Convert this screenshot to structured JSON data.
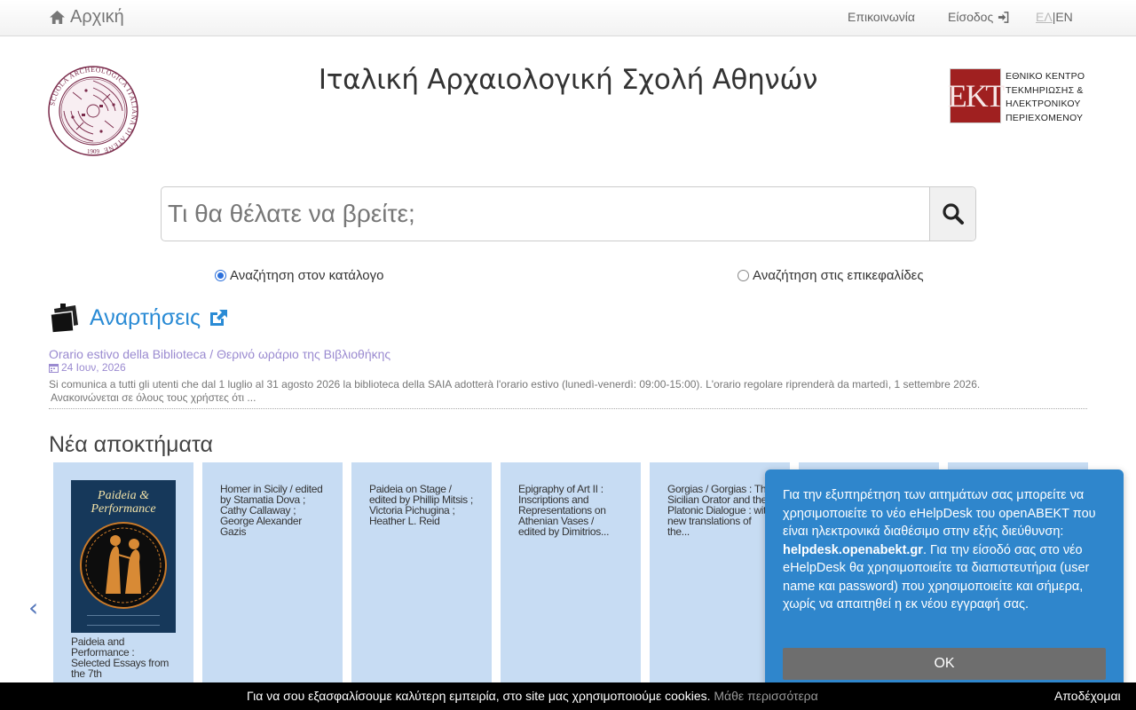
{
  "topnav": {
    "home_label": "Αρχική",
    "contact_label": "Επικοινωνία",
    "login_label": "Είσοδος",
    "lang_el": "ΕΛ",
    "lang_sep": "|",
    "lang_en": "EN"
  },
  "header": {
    "title": "Ιταλική Αρχαιολογική Σχολή Αθηνών",
    "ekt_logo": "ΕΚΤ",
    "ekt_lines": [
      "ΕΘΝΙΚΟ ΚΕΝΤΡΟ",
      "ΤΕΚΜΗΡΙΩΣΗΣ &",
      "ΗΛΕΚΤΡΟΝΙΚΟΥ",
      "ΠΕΡΙΕΧΟΜΕΝΟΥ"
    ],
    "saia_logo_text": "SCUOLA ARCHEOLOGICA ITALIANA DI ATENE",
    "saia_logo_year": "1909"
  },
  "search": {
    "placeholder": "Τι θα θέλατε να βρείτε;",
    "value": "",
    "options": [
      {
        "label": "Αναζήτηση στον κατάλογο",
        "selected": true
      },
      {
        "label": "Αναζήτηση στις επικεφαλίδες",
        "selected": false
      }
    ]
  },
  "announcements": {
    "title": "Αναρτήσεις",
    "item": {
      "link": "Orario estivo della Biblioteca / Θερινό ωράριο της Βιβλιοθήκης",
      "date": "24 Ιουν, 2026",
      "body_line1": "Si comunica a tutti gli utenti che dal 1 luglio al 31 agosto 2026 la biblioteca della SAIA adotterà l'orario estivo (lunedì-venerdì: 09:00-15:00). L'orario regolare riprenderà da martedì, 1 settembre 2026.",
      "body_line2": "Ανακοινώνεται σε όλους τους χρήστες ότι ..."
    }
  },
  "acquisitions": {
    "title": "Νέα αποκτήματα",
    "prev_label": "‹",
    "items": [
      {
        "text": "Paideia and Performance : Selected Essays from the 7th",
        "cover_title": "Paideia & Performance"
      },
      {
        "text": "Homer in Sicily / edited by Stamatia Dova ; Cathy Callaway ; George Alexander Gazis"
      },
      {
        "text": "Paideia on Stage / edited by Phillip Mitsis ; Victoria Pichugina ; Heather L. Reid"
      },
      {
        "text": "Epigraphy of Art II : Inscriptions and Representations on Athenian Vases / edited by Dimitrios..."
      },
      {
        "text": "Gorgias / Gorgias : The Sicilian Orator and the Platonic Dialogue : with new translations of the..."
      },
      {
        "text": ""
      },
      {
        "text": ""
      }
    ]
  },
  "popup": {
    "text_before": "Για την εξυπηρέτηση των αιτημάτων σας μπορείτε να χρησιμοποιείτε το νέο eHelpDesk του openABEKT που είναι ηλεκτρονικά διαθέσιμο στην εξής διεύθυνση: ",
    "link": "helpdesk.openabekt.gr",
    "text_after": ". Για την είσοδό σας στο νέο eHelpDesk θα χρησιμοποιείτε τα διαπιστευτήρια (user name και password) που χρησιμοποιείτε και σήμερα, χωρίς να απαιτηθεί η εκ νέου εγγραφή σας.",
    "ok_label": "OK"
  },
  "cookie": {
    "message": "Για να σου εξασφαλίσουμε καλύτερη εμπειρία, στο site μας χρησιμοποιούμε cookies.",
    "more_label": "Μάθε περισσότερα",
    "accept_label": "Αποδέχομαι"
  },
  "colors": {
    "accent_blue": "#2a8bd5",
    "card_bg": "#c7dcf3",
    "popup_bg": "#2f86cc",
    "link_purple": "#9a8ad0"
  }
}
